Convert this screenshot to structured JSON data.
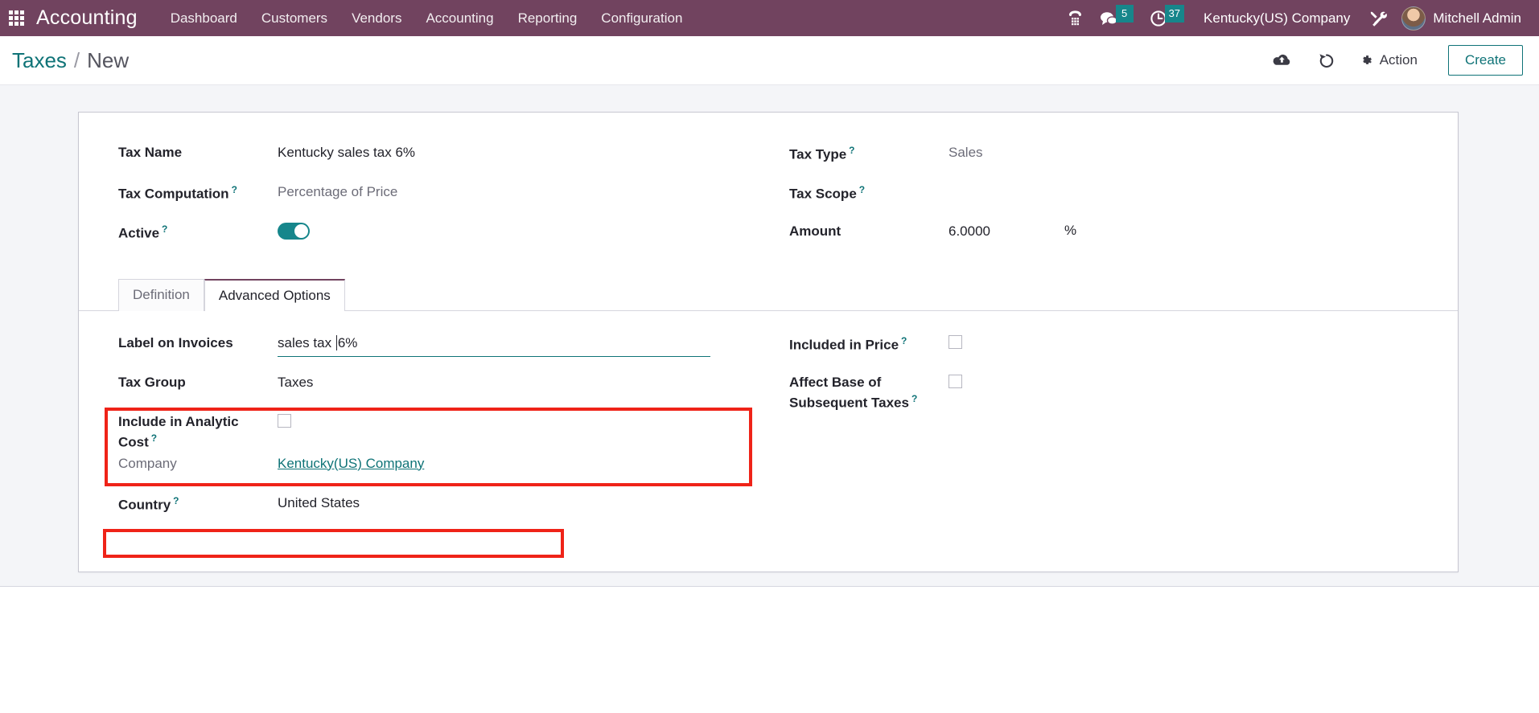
{
  "navbar": {
    "apps_icon": "apps-grid-icon",
    "brand": "Accounting",
    "menu": [
      {
        "label": "Dashboard"
      },
      {
        "label": "Customers"
      },
      {
        "label": "Vendors"
      },
      {
        "label": "Accounting"
      },
      {
        "label": "Reporting"
      },
      {
        "label": "Configuration"
      }
    ],
    "phone_icon": "phone-dialpad-icon",
    "messages_icon": "chat-bubble-icon",
    "messages_count": "5",
    "activities_icon": "clock-icon",
    "activities_count": "37",
    "company": "Kentucky(US) Company",
    "tools_icon": "wrench-screwdriver-icon",
    "avatar": "user-avatar",
    "user": "Mitchell Admin"
  },
  "control_panel": {
    "breadcrumb_root": "Taxes",
    "breadcrumb_sep": "/",
    "breadcrumb_current": "New",
    "save_icon": "cloud-upload-icon",
    "discard_icon": "undo-icon",
    "action_icon": "gear-icon",
    "action_label": "Action",
    "create_label": "Create"
  },
  "form": {
    "tax_name": {
      "label": "Tax Name",
      "value": "Kentucky sales tax 6%"
    },
    "tax_computation": {
      "label": "Tax Computation",
      "help": "?",
      "value": "Percentage of Price"
    },
    "active": {
      "label": "Active",
      "help": "?",
      "value": "on"
    },
    "tax_type": {
      "label": "Tax Type",
      "help": "?",
      "value": "Sales"
    },
    "tax_scope": {
      "label": "Tax Scope",
      "help": "?",
      "value": ""
    },
    "amount": {
      "label": "Amount",
      "value": "6.0000",
      "suffix": "%"
    }
  },
  "tabs": [
    {
      "label": "Definition",
      "active": false
    },
    {
      "label": "Advanced Options",
      "active": true
    }
  ],
  "advanced_options": {
    "label_on_invoices": {
      "label": "Label on Invoices",
      "value_before_caret": "sales tax ",
      "value_after_caret": "6%"
    },
    "tax_group": {
      "label": "Tax Group",
      "value": "Taxes"
    },
    "include_analytic_cost": {
      "label": "Include in Analytic Cost",
      "help": "?",
      "checked": false
    },
    "company": {
      "label": "Company",
      "value": "Kentucky(US) Company"
    },
    "country": {
      "label": "Country",
      "help": "?",
      "value": "United States"
    },
    "included_in_price": {
      "label": "Included in Price",
      "help": "?",
      "checked": false
    },
    "affect_base_line1": {
      "label": "Affect Base of"
    },
    "affect_base_line2": {
      "label": "Subsequent Taxes",
      "help": "?",
      "checked": false
    }
  },
  "colors": {
    "navbar_purple": "#71435f",
    "accent_teal": "#0f7377",
    "badge_teal": "#17868b",
    "highlight_red": "#ef2318",
    "body_gray": "#f4f5f8"
  }
}
